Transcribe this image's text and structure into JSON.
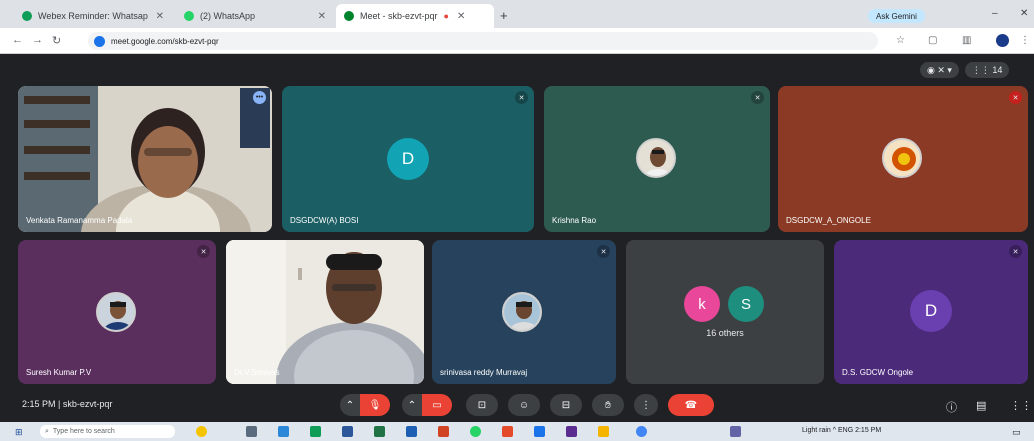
{
  "browser": {
    "tabs": [
      {
        "title": "Webex Reminder: Whatsap",
        "active": false
      },
      {
        "title": "(2) WhatsApp",
        "active": false
      },
      {
        "title": "Meet - skb-ezvt-pqr",
        "active": true
      }
    ],
    "new_tab_icon": "plus-icon",
    "profile_chip": "Ask Gemini",
    "url": "meet.google.com/skb-ezvt-pqr"
  },
  "meet": {
    "top_pills": [
      {
        "label": "◉ ✕ ▾",
        "icon": "recording-icon"
      },
      {
        "label": "⋮⋮ 14",
        "icon": "participants-icon"
      }
    ],
    "tiles": [
      {
        "name": "Venkata Ramanamma Padala",
        "kind": "video"
      },
      {
        "name": "DSGDCW(A) BOSI",
        "kind": "letter",
        "letter": "D",
        "bg": "#1b5e63",
        "avatar_bg": "#12a4b5"
      },
      {
        "name": "Krishna Rao",
        "kind": "photo",
        "bg": "#2e5b4f"
      },
      {
        "name": "DSGDCW_A_ONGOLE",
        "kind": "photo",
        "bg": "#8a3a25"
      },
      {
        "name": "Suresh Kumar P.V",
        "kind": "photo",
        "bg": "#5a2f5e"
      },
      {
        "name": "Dr.V.Srinivas",
        "kind": "video"
      },
      {
        "name": "srinivasa reddy Murravaj",
        "kind": "photo",
        "bg": "#26425c"
      },
      {
        "name": "16 others",
        "kind": "others",
        "bg": "#3c4043",
        "letters": [
          "k",
          "S"
        ]
      },
      {
        "name": "D.S. GDCW Ongole",
        "kind": "letter",
        "letter": "D",
        "bg": "#4b2a7a",
        "avatar_bg": "#6a3fb0"
      }
    ],
    "meeting_info": "2:15 PM  |  skb-ezvt-pqr"
  },
  "taskbar": {
    "search_placeholder": "Type here to search",
    "tray_text": "Light rain  ^  ENG  2:15 PM"
  },
  "colors": {
    "leave_red": "#ea4335",
    "control_grey": "#3c4043",
    "background": "#202124"
  }
}
